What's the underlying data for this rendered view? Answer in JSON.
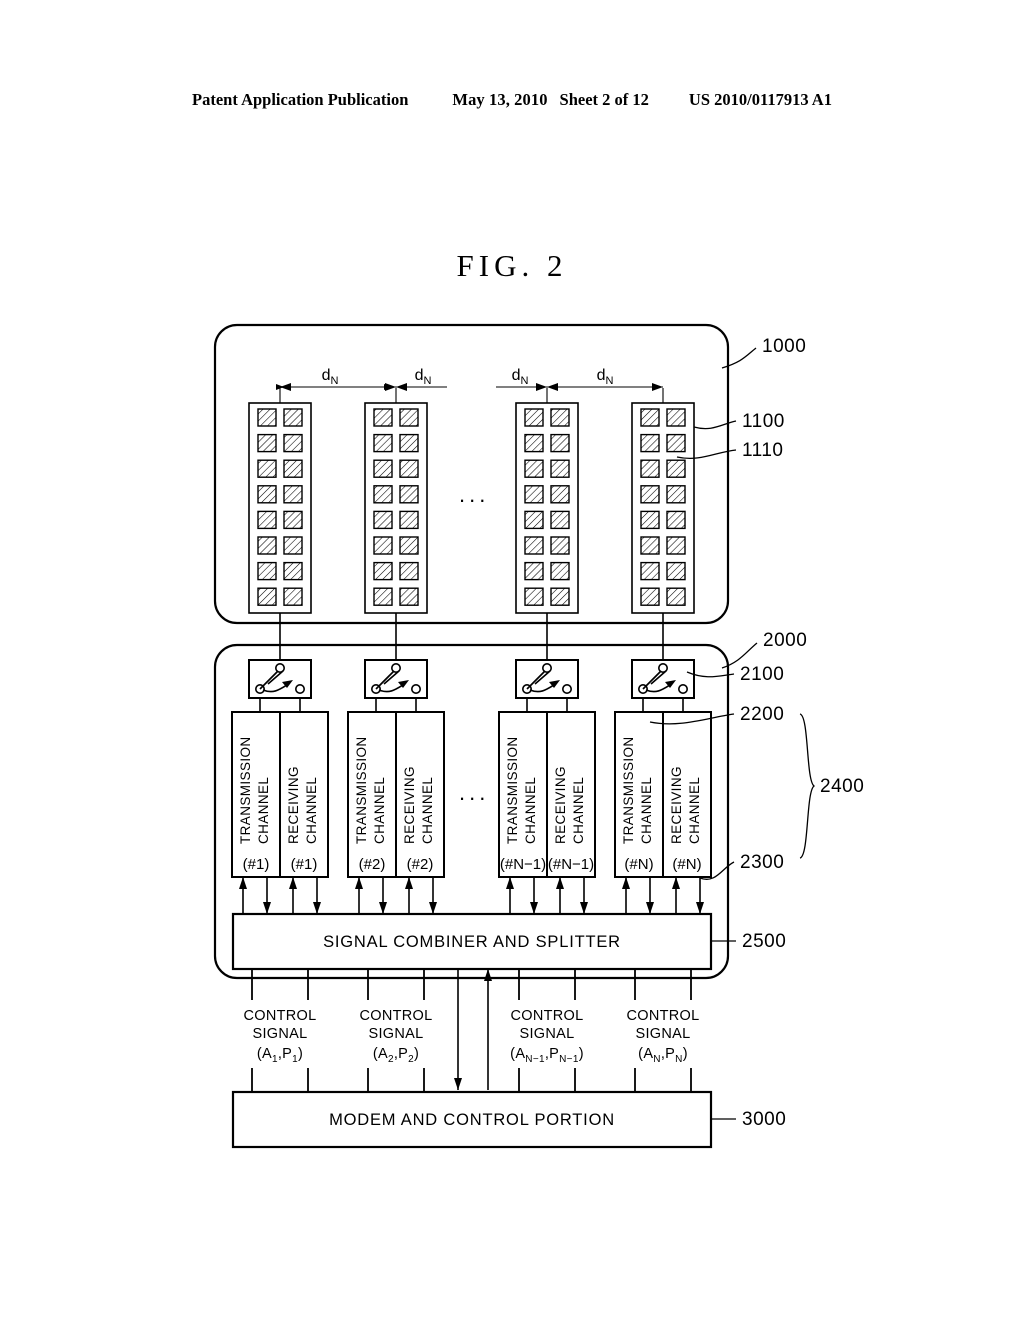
{
  "header": {
    "left": "Patent Application Publication",
    "date": "May 13, 2010",
    "sheet": "Sheet 2 of 12",
    "pubnum": "US 2010/0117913 A1"
  },
  "figure": {
    "title": "FIG. 2",
    "ellipsis": "..."
  },
  "antenna_section": {
    "ref": "1000",
    "panel_ref": "1100",
    "element_ref": "1110",
    "spacing_label": "d",
    "spacing_sub": "N",
    "panel_rows": 8,
    "panel_cols": 2
  },
  "rf_section": {
    "ref": "2000",
    "switch_ref": "2100",
    "tx_ref": "2200",
    "rx_ref": "2300",
    "pair_ref": "2400",
    "combiner_ref": "2500",
    "combiner_label": "SIGNAL COMBINER AND SPLITTER",
    "tx_label_line1": "TRANSMISSION",
    "tx_label_line2": "CHANNEL",
    "rx_label_line1": "RECEIVING",
    "rx_label_line2": "CHANNEL",
    "channels": [
      {
        "index": "(#1)"
      },
      {
        "index": "(#2)"
      },
      {
        "index": "(#N−1)"
      },
      {
        "index": "(#N)"
      }
    ]
  },
  "control_signals": [
    {
      "line1": "CONTROL",
      "line2": "SIGNAL",
      "amp": "A",
      "amp_sub": "1",
      "phase": "P",
      "phase_sub": "1"
    },
    {
      "line1": "CONTROL",
      "line2": "SIGNAL",
      "amp": "A",
      "amp_sub": "2",
      "phase": "P",
      "phase_sub": "2"
    },
    {
      "line1": "CONTROL",
      "line2": "SIGNAL",
      "amp": "A",
      "amp_sub": "N−1",
      "phase": "P",
      "phase_sub": "N−1"
    },
    {
      "line1": "CONTROL",
      "line2": "SIGNAL",
      "amp": "A",
      "amp_sub": "N",
      "phase": "P",
      "phase_sub": "N"
    }
  ],
  "modem": {
    "ref": "3000",
    "label": "MODEM AND CONTROL PORTION"
  },
  "colors": {
    "ink": "#000000",
    "paper": "#ffffff"
  }
}
